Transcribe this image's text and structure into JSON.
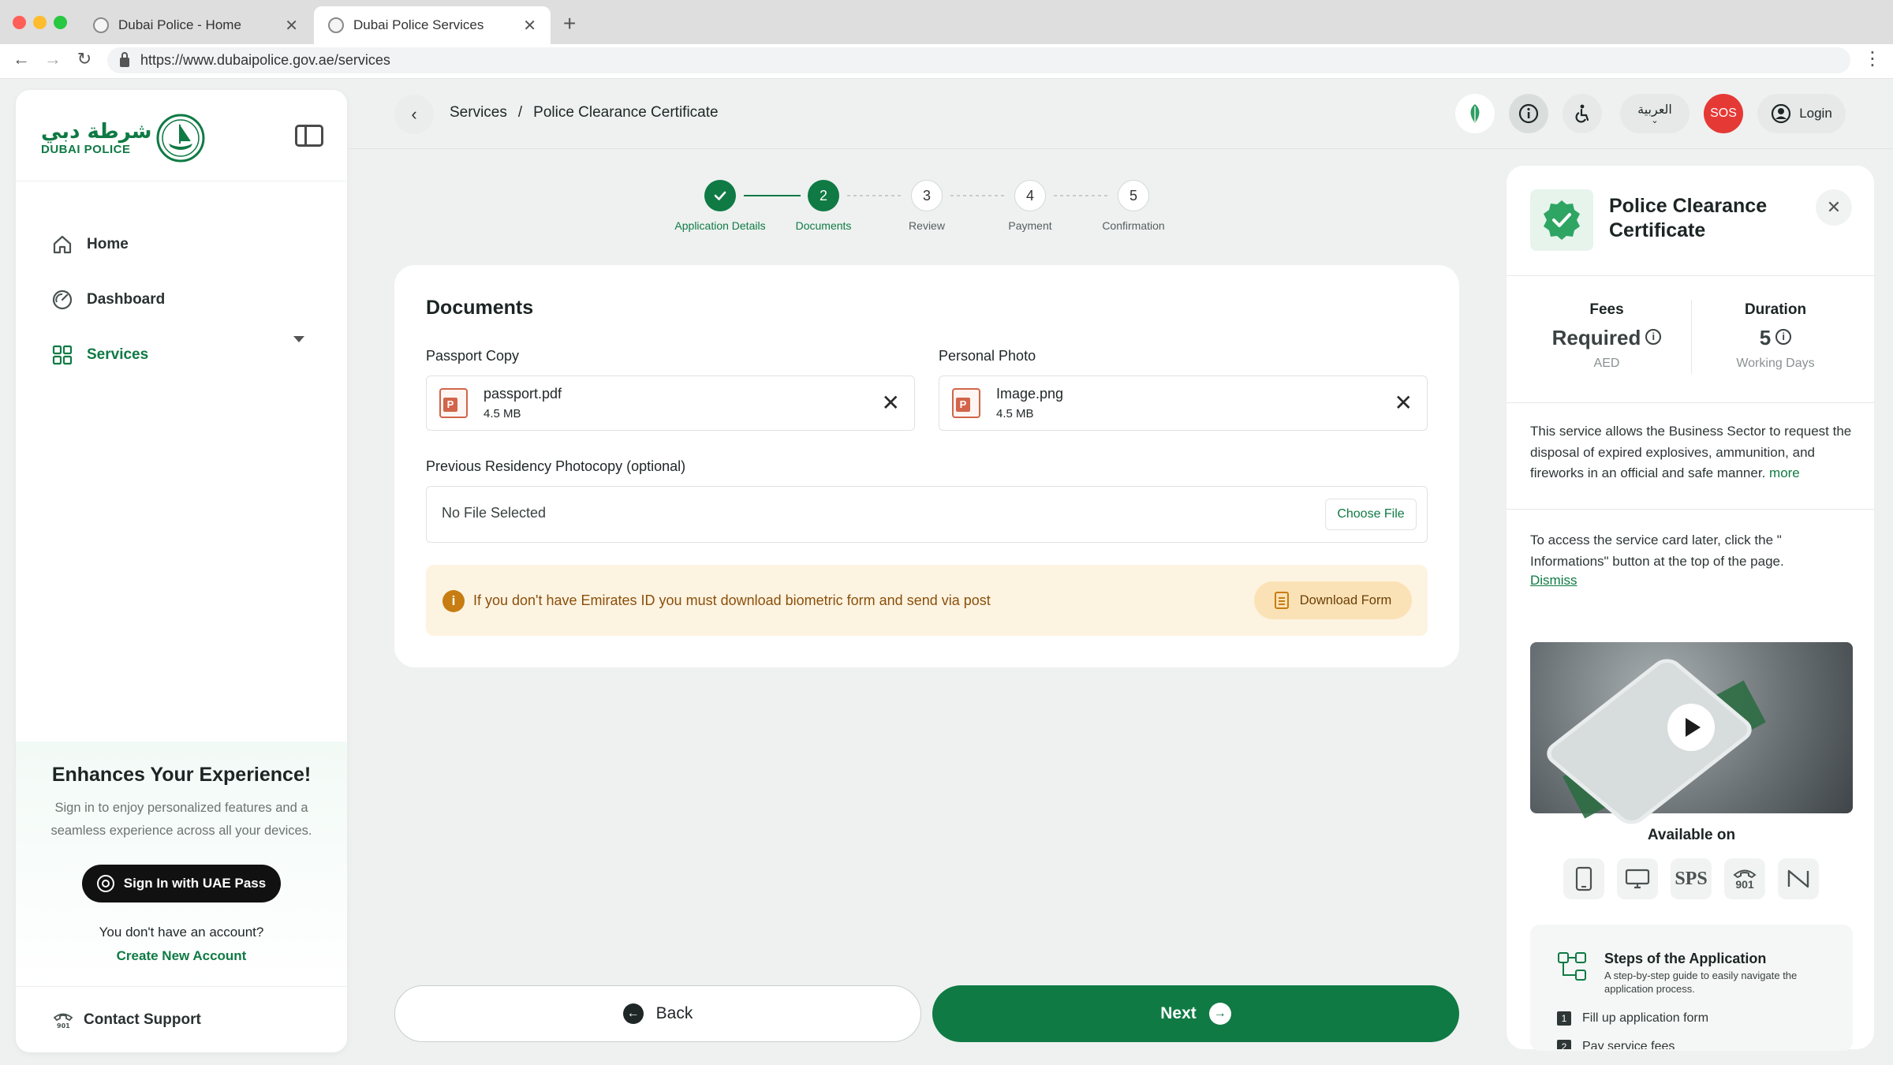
{
  "browser": {
    "tabs": [
      {
        "title": "Dubai Police - Home"
      },
      {
        "title": "Dubai Police Services"
      }
    ],
    "url": "https://www.dubaipolice.gov.ae/services"
  },
  "sidebar": {
    "logo_ar": "شرطة دبي",
    "logo_en": "DUBAI POLICE",
    "items": [
      {
        "label": "Home",
        "icon": "home-icon"
      },
      {
        "label": "Dashboard",
        "icon": "dashboard-icon"
      },
      {
        "label": "Services",
        "icon": "grid-icon",
        "active": true
      }
    ],
    "promo": {
      "title": "Enhances Your Experience!",
      "text": "Sign in to enjoy personalized features and a seamless experience across all your devices.",
      "uaepass_label": "Sign In with UAE Pass",
      "no_account": "You don't have an account?",
      "create_account": "Create New Account"
    },
    "contact_support": "Contact Support"
  },
  "header": {
    "breadcrumb": [
      "Services",
      "/",
      "Police Clearance Certificate"
    ],
    "lang_label": "العربية",
    "sos_label": "SOS",
    "login_label": "Login"
  },
  "stepper": {
    "steps": [
      {
        "num": "",
        "label": "Application Details",
        "state": "done"
      },
      {
        "num": "2",
        "label": "Documents",
        "state": "current"
      },
      {
        "num": "3",
        "label": "Review",
        "state": "todo"
      },
      {
        "num": "4",
        "label": "Payment",
        "state": "todo"
      },
      {
        "num": "5",
        "label": "Confirmation",
        "state": "todo"
      }
    ]
  },
  "documents": {
    "title": "Documents",
    "passport": {
      "label": "Passport Copy",
      "file_name": "passport.pdf",
      "file_size": "4.5 MB"
    },
    "photo": {
      "label": "Personal Photo",
      "file_name": "Image.png",
      "file_size": "4.5 MB"
    },
    "residency": {
      "label": "Previous Residency Photocopy (optional)",
      "status": "No File Selected",
      "choose_label": "Choose File"
    },
    "alert": {
      "text": "If you don't have Emirates ID you must download biometric form and send via post",
      "button_label": "Download Form"
    }
  },
  "footer_buttons": {
    "back_label": "Back",
    "next_label": "Next"
  },
  "service_panel": {
    "title": "Police Clearance Certificate",
    "fees": {
      "label": "Fees",
      "value": "Required",
      "unit": "AED"
    },
    "duration": {
      "label": "Duration",
      "value": "5",
      "unit": "Working Days"
    },
    "description": "This service allows the Business Sector to request the disposal of expired explosives, ammunition, and fireworks in an official and safe manner.",
    "more_label": "more",
    "hint": "To access the service card later, click the \" Informations\" button at the top of the page.",
    "dismiss_label": "Dismiss",
    "available_on": "Available on",
    "channels": [
      {
        "icon": "smartphone-icon",
        "text": ""
      },
      {
        "icon": "desktop-icon",
        "text": ""
      },
      {
        "icon": "sps-icon",
        "text": "SPS"
      },
      {
        "icon": "phone-901-icon",
        "text": "901"
      },
      {
        "icon": "ai-assistant-icon",
        "text": ""
      }
    ],
    "steps_card": {
      "title": "Steps of the Application",
      "subtitle": "A step-by-step guide to easily navigate the application process.",
      "items": [
        {
          "num": "1",
          "label": "Fill up application form"
        },
        {
          "num": "2",
          "label": "Pay service fees"
        }
      ]
    }
  },
  "colors": {
    "brand": "#0f7a44",
    "sos": "#e53935",
    "alert_bg": "#fdf3e1"
  }
}
